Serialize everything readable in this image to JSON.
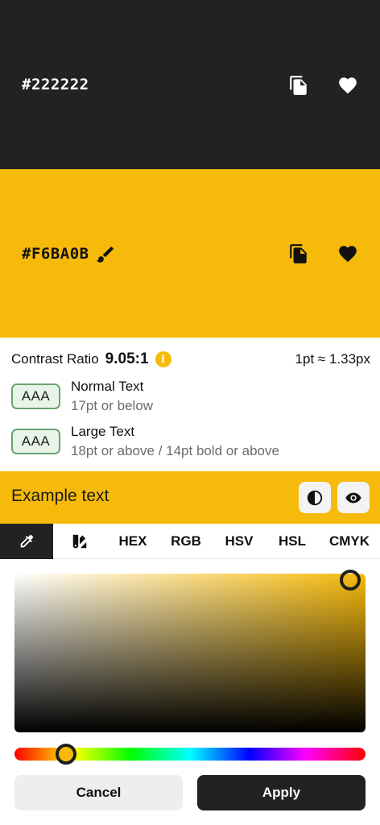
{
  "colors": {
    "background_color": "#222222",
    "foreground_color": "#F6BA0B",
    "accent": "#F6BA0B"
  },
  "background_panel": {
    "hex": "#222222",
    "copy_icon": "copy-icon",
    "favorite_icon": "heart-icon"
  },
  "foreground_panel": {
    "hex": "#F6BA0B",
    "edit_icon": "paint-brush-icon",
    "copy_icon": "copy-icon",
    "favorite_icon": "heart-icon"
  },
  "contrast": {
    "label": "Contrast Ratio",
    "value": "9.05:1",
    "info_icon": "i",
    "pt_conversion": "1pt ≈ 1.33px"
  },
  "ratings": [
    {
      "badge": "AAA",
      "title": "Normal Text",
      "subtitle": "17pt or below"
    },
    {
      "badge": "AAA",
      "title": "Large Text",
      "subtitle": "18pt or above / 14pt bold or above"
    }
  ],
  "example": {
    "text": "Example text",
    "contrast_toggle_icon": "contrast-icon",
    "preview_icon": "eye-icon"
  },
  "tabs": [
    {
      "icon": "eyedropper-icon",
      "active": true
    },
    {
      "icon": "swatches-icon",
      "active": false
    },
    {
      "label": "HEX"
    },
    {
      "label": "RGB"
    },
    {
      "label": "HSV"
    },
    {
      "label": "HSL"
    },
    {
      "label": "CMYK"
    }
  ],
  "picker": {
    "saturation": 0.96,
    "value": 0.96,
    "hue_degrees": 45
  },
  "actions": {
    "cancel": "Cancel",
    "apply": "Apply"
  }
}
